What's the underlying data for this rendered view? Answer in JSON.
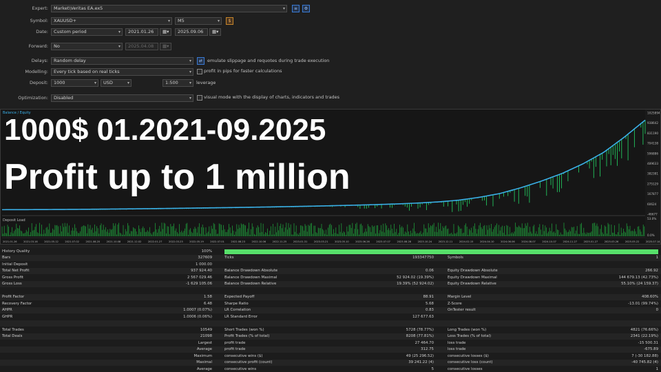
{
  "settings": {
    "expert": {
      "label": "Expert:",
      "value": "Market\\Veritas EA.ex5"
    },
    "symbol": {
      "label": "Symbol:",
      "value": "XAUUSD+",
      "period": "M5"
    },
    "date": {
      "label": "Date:",
      "mode": "Custom period",
      "from": "2021.01.26",
      "to": "2025.09.06"
    },
    "forward": {
      "label": "Forward:",
      "mode": "No",
      "date": "2025.04.08"
    },
    "delays": {
      "label": "Delays:",
      "value": "Random delay",
      "check_label": "emulate slippage and requotes during trade execution"
    },
    "modelling": {
      "label": "Modelling:",
      "value": "Every tick based on real ticks",
      "check_label": "profit in pips for faster calculations"
    },
    "deposit": {
      "label": "Deposit:",
      "value": "1000",
      "currency": "USD",
      "leverage": "1:500",
      "leverage_label": "leverage"
    },
    "optimization": {
      "label": "Optimization:",
      "value": "Disabled",
      "check_label": "visual mode with the display of charts, indicators and trades"
    }
  },
  "overlay": {
    "line1": "1000$ 01.2021-09.2025",
    "line2": "Profit up to 1 million"
  },
  "chart_data": {
    "type": "line",
    "legend": "Balance / Equity",
    "x": [
      "2021.01.26",
      "2021.03.16",
      "2021.05.12",
      "2021.07.02",
      "2021.08.20",
      "2021.10.08",
      "2021.12.02",
      "2022.01.27",
      "2022.03.23",
      "2022.05.19",
      "2022.07.01",
      "2022.08.23",
      "2022.10.06",
      "2022.11.25",
      "2023.01.31",
      "2023.03.21",
      "2023.05.10",
      "2023.06.26",
      "2023.07.07",
      "2023.08.28",
      "2023.10.24",
      "2023.12.11",
      "2024.02.15",
      "2024.04.10",
      "2024.06.06",
      "2024.08.07",
      "2024.10.07",
      "2024.11.27",
      "2025.01.27",
      "2025.03.26",
      "2025.05.22",
      "2025.07.14"
    ],
    "series": [
      {
        "name": "Balance",
        "color": "#3ab0e8",
        "values": [
          1000,
          1500,
          2500,
          3500,
          5000,
          7000,
          9000,
          11500,
          14000,
          17000,
          20000,
          23000,
          26500,
          30000,
          34000,
          38000,
          43000,
          48000,
          54000,
          61000,
          70000,
          82000,
          100000,
          130000,
          170000,
          230000,
          300000,
          380000,
          480000,
          600000,
          760000,
          937000
        ]
      },
      {
        "name": "Equity",
        "color": "#22c55e"
      }
    ],
    "y_ticks": [
      "1025894",
      "938642",
      "831190",
      "704138",
      "596886",
      "489633",
      "382381",
      "275129",
      "167877",
      "60624",
      "-46677"
    ],
    "ylim": [
      -46677,
      1025894
    ],
    "deposit_load": {
      "label": "Deposit Load",
      "y_ticks": [
        "53.0%",
        "0.0%"
      ]
    }
  },
  "stats": {
    "quality": {
      "label": "History Quality",
      "value": "100%"
    },
    "rows": [
      {
        "l": "Bars",
        "lv": "327609",
        "m": "Ticks",
        "mv": "193347750",
        "r": "Symbols",
        "rv": "1"
      },
      {
        "l": "Initial Deposit",
        "lv": "1 000.00",
        "m": "",
        "mv": "",
        "r": "",
        "rv": ""
      },
      {
        "l": "Total Net Profit",
        "lv": "937 924.40",
        "m": "Balance Drawdown Absolute",
        "mv": "0.06",
        "r": "Equity Drawdown Absolute",
        "rv": "266.92"
      },
      {
        "l": "Gross Profit",
        "lv": "2 567 029.46",
        "m": "Balance Drawdown Maximal",
        "mv": "52 924.02 (19.39%)",
        "r": "Equity Drawdown Maximal",
        "rv": "144 679.13 (42.73%)"
      },
      {
        "l": "Gross Loss",
        "lv": "-1 629 105.06",
        "m": "Balance Drawdown Relative",
        "mv": "19.39% (52 924.02)",
        "r": "Equity Drawdown Relative",
        "rv": "55.10% (24 159.37)"
      },
      {
        "l": "",
        "lv": "",
        "m": "",
        "mv": "",
        "r": "",
        "rv": ""
      },
      {
        "l": "Profit Factor",
        "lv": "1.58",
        "m": "Expected Payoff",
        "mv": "88.91",
        "r": "Margin Level",
        "rv": "408.60%"
      },
      {
        "l": "Recovery Factor",
        "lv": "6.48",
        "m": "Sharpe Ratio",
        "mv": "5.68",
        "r": "Z-Score",
        "rv": "-13.01 (99.74%)"
      },
      {
        "l": "AHPR",
        "lv": "1.0007 (0.07%)",
        "m": "LR Correlation",
        "mv": "0.83",
        "r": "OnTester result",
        "rv": "0"
      },
      {
        "l": "GHPR",
        "lv": "1.0006 (0.06%)",
        "m": "LR Standard Error",
        "mv": "127 677.63",
        "r": "",
        "rv": ""
      },
      {
        "l": "",
        "lv": "",
        "m": "",
        "mv": "",
        "r": "",
        "rv": ""
      },
      {
        "l": "Total Trades",
        "lv": "10549",
        "m": "Short Trades (won %)",
        "mv": "5728 (78.77%)",
        "r": "Long Trades (won %)",
        "rv": "4821 (76.66%)"
      },
      {
        "l": "Total Deals",
        "lv": "21098",
        "m": "Profit Trades (% of total)",
        "mv": "8208 (77.81%)",
        "r": "Loss Trades (% of total)",
        "rv": "2341 (22.19%)"
      },
      {
        "l": "Largest",
        "lv": "",
        "m": "profit trade",
        "mv": "27 464.70",
        "r": "loss trade",
        "rv": "-15 500.31",
        "indent": true
      },
      {
        "l": "Average",
        "lv": "",
        "m": "profit trade",
        "mv": "312.75",
        "r": "loss trade",
        "rv": "-675.89",
        "indent": true
      },
      {
        "l": "Maximum",
        "lv": "",
        "m": "consecutive wins ($)",
        "mv": "49 (25 296.52)",
        "r": "consecutive losses ($)",
        "rv": "7 (-30 182.88)",
        "indent": true
      },
      {
        "l": "Maximal",
        "lv": "",
        "m": "consecutive profit (count)",
        "mv": "39 241.22 (4)",
        "r": "consecutive loss (count)",
        "rv": "-40 745.82 (4)",
        "indent": true
      },
      {
        "l": "Average",
        "lv": "",
        "m": "consecutive wins",
        "mv": "5",
        "r": "consecutive losses",
        "rv": "1",
        "indent": true
      }
    ]
  }
}
